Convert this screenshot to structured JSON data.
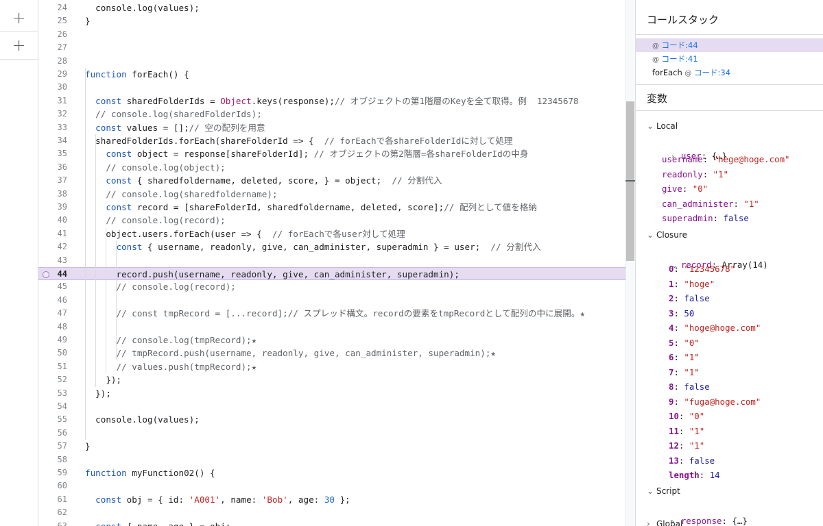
{
  "left_rail": {
    "buttons": [
      "+",
      "+"
    ]
  },
  "editor": {
    "breakpoint_line": 44,
    "lines": [
      {
        "n": "24",
        "t": "  console.log(values);"
      },
      {
        "n": "25",
        "t": "}"
      },
      {
        "n": "26",
        "t": ""
      },
      {
        "n": "27",
        "t": ""
      },
      {
        "n": "28",
        "t": ""
      },
      {
        "n": "29",
        "t": "function forEach() {"
      },
      {
        "n": "30",
        "t": ""
      },
      {
        "n": "31",
        "t": "  const sharedFolderIds = Object.keys(response);// オブジェクトの第1階層のKeyを全て取得。例  12345678"
      },
      {
        "n": "32",
        "t": "  // console.log(sharedFolderIds);"
      },
      {
        "n": "33",
        "t": "  const values = [];// 空の配列を用意"
      },
      {
        "n": "34",
        "t": "  sharedFolderIds.forEach(shareFolderId => {  // forEachで各shareFolderIdに対して処理"
      },
      {
        "n": "35",
        "t": "    const object = response[shareFolderId]; // オブジェクトの第2階層=各shareFolderIdの中身"
      },
      {
        "n": "36",
        "t": "    // console.log(object);"
      },
      {
        "n": "37",
        "t": "    const { sharedfoldername, deleted, score, } = object;  // 分割代入"
      },
      {
        "n": "38",
        "t": "    // console.log(sharedfoldername);"
      },
      {
        "n": "39",
        "t": "    const record = [shareFolderId, sharedfoldername, deleted, score];// 配列として値を格納"
      },
      {
        "n": "40",
        "t": "    // console.log(record);"
      },
      {
        "n": "41",
        "t": "    object.users.forEach(user => {  // forEachで各user対して処理"
      },
      {
        "n": "42",
        "t": "      const { username, readonly, give, can_administer, superadmin } = user;  // 分割代入"
      },
      {
        "n": "43",
        "t": ""
      },
      {
        "n": "44",
        "t": "      record.push(username, readonly, give, can_administer, superadmin);"
      },
      {
        "n": "45",
        "t": "      // console.log(record);"
      },
      {
        "n": "46",
        "t": ""
      },
      {
        "n": "47",
        "t": "      // const tmpRecord = [...record];// スプレッド構文。recordの要素をtmpRecordとして配列の中に展開。★"
      },
      {
        "n": "48",
        "t": ""
      },
      {
        "n": "49",
        "t": "      // console.log(tmpRecord);★"
      },
      {
        "n": "50",
        "t": "      // tmpRecord.push(username, readonly, give, can_administer, superadmin);★"
      },
      {
        "n": "51",
        "t": "      // values.push(tmpRecord);★"
      },
      {
        "n": "52",
        "t": "    });"
      },
      {
        "n": "53",
        "t": "  });"
      },
      {
        "n": "54",
        "t": ""
      },
      {
        "n": "55",
        "t": "  console.log(values);"
      },
      {
        "n": "56",
        "t": ""
      },
      {
        "n": "57",
        "t": "}"
      },
      {
        "n": "58",
        "t": ""
      },
      {
        "n": "59",
        "t": "function myFunction02() {"
      },
      {
        "n": "60",
        "t": ""
      },
      {
        "n": "61",
        "t": "  const obj = { id: 'A001', name: 'Bob', age: 30 };"
      },
      {
        "n": "62",
        "t": ""
      },
      {
        "n": "63",
        "t": "  const { name, age } = obj;"
      }
    ]
  },
  "panel": {
    "call_stack_title": "コールスタック",
    "frames": [
      {
        "fn": "",
        "at": "@",
        "loc": "コード:44",
        "selected": true
      },
      {
        "fn": "",
        "at": "@",
        "loc": "コード:41",
        "selected": false
      },
      {
        "fn": "forEach",
        "at": "@",
        "loc": "コード:34",
        "selected": false
      }
    ],
    "variables_title": "変数",
    "local": {
      "label": "Local",
      "user_key": "user",
      "user_value": "{…}",
      "props": [
        {
          "k": "username",
          "v": "\"hege@hoge.com\"",
          "t": "s"
        },
        {
          "k": "readonly",
          "v": "\"1\"",
          "t": "s"
        },
        {
          "k": "give",
          "v": "\"0\"",
          "t": "s"
        },
        {
          "k": "can_administer",
          "v": "\"1\"",
          "t": "s"
        },
        {
          "k": "superadmin",
          "v": "false",
          "t": "b"
        }
      ]
    },
    "closure": {
      "label": "Closure",
      "record_key": "record",
      "record_value": "Array(14)",
      "items": [
        {
          "k": "0",
          "v": "\"12345678\"",
          "t": "s"
        },
        {
          "k": "1",
          "v": "\"hoge\"",
          "t": "s"
        },
        {
          "k": "2",
          "v": "false",
          "t": "b"
        },
        {
          "k": "3",
          "v": "50",
          "t": "b"
        },
        {
          "k": "4",
          "v": "\"hoge@hoge.com\"",
          "t": "s"
        },
        {
          "k": "5",
          "v": "\"0\"",
          "t": "s"
        },
        {
          "k": "6",
          "v": "\"1\"",
          "t": "s"
        },
        {
          "k": "7",
          "v": "\"1\"",
          "t": "s"
        },
        {
          "k": "8",
          "v": "false",
          "t": "b"
        },
        {
          "k": "9",
          "v": "\"fuga@hoge.com\"",
          "t": "s"
        },
        {
          "k": "10",
          "v": "\"0\"",
          "t": "s"
        },
        {
          "k": "11",
          "v": "\"1\"",
          "t": "s"
        },
        {
          "k": "12",
          "v": "\"1\"",
          "t": "s"
        },
        {
          "k": "13",
          "v": "false",
          "t": "b"
        },
        {
          "k": "length",
          "v": "14",
          "t": "b"
        }
      ]
    },
    "script": {
      "label": "Script",
      "response_key": "response",
      "response_value": "{…}"
    },
    "global_label": "Global"
  },
  "colors": {
    "highlight": "#e5dcf1",
    "keyword": "#1a57b8",
    "string": "#c5221f",
    "comment": "#5f6368",
    "link": "#1a73e8"
  }
}
